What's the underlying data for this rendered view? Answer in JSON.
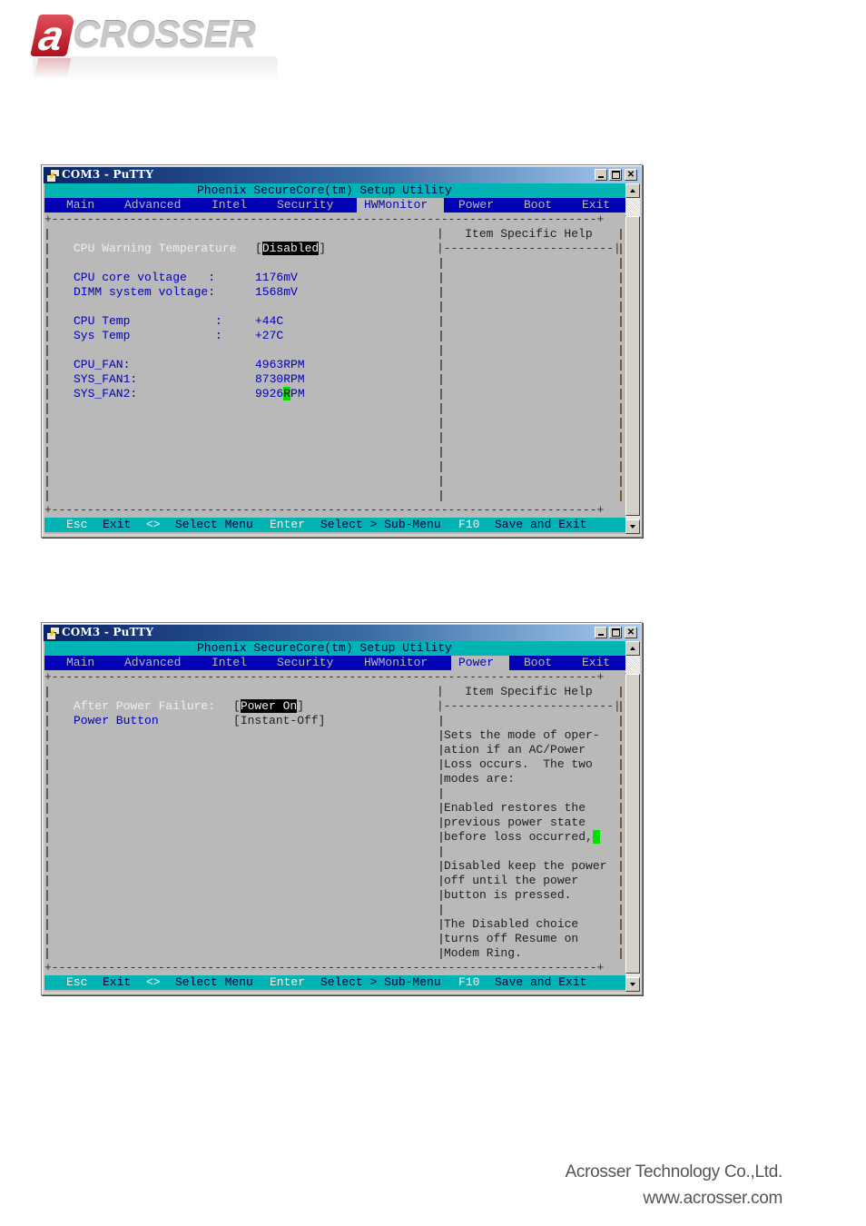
{
  "logo": {
    "mark": "a",
    "text": "CROSSER"
  },
  "windows": [
    {
      "title": "COM3 - PuTTY",
      "banner": "Phoenix SecureCore(tm) Setup Utility",
      "menu": [
        "Main",
        "Advanced",
        "Intel",
        "Security",
        "HWMonitor",
        "Power",
        "Boot",
        "Exit"
      ],
      "selected_menu": "HWMonitor",
      "help_title": "Item Specific Help",
      "items": [
        {
          "label": "CPU Warning Temperature",
          "value": "Disabled",
          "selected": true
        },
        {
          "label": "CPU core voltage   :",
          "value": "1176mV"
        },
        {
          "label": "DIMM system voltage:",
          "value": "1568mV"
        },
        {
          "label": "CPU Temp            :",
          "value": "+44C"
        },
        {
          "label": "Sys Temp            :",
          "value": "+27C"
        },
        {
          "label": "CPU_FAN:",
          "value": "4963RPM"
        },
        {
          "label": "SYS_FAN1:",
          "value": "8730RPM"
        },
        {
          "label": "SYS_FAN2:",
          "value_pre": "9926",
          "value_cursor": "R",
          "value_post": "PM"
        }
      ],
      "help_lines": [],
      "footer": [
        {
          "key": "Esc",
          "desc": "Exit"
        },
        {
          "key": "<>",
          "desc": "Select Menu"
        },
        {
          "key": "Enter",
          "desc": "Select > Sub-Menu"
        },
        {
          "key": "F10",
          "desc": "Save and Exit"
        }
      ]
    },
    {
      "title": "COM3 - PuTTY",
      "banner": "Phoenix SecureCore(tm) Setup Utility",
      "menu": [
        "Main",
        "Advanced",
        "Intel",
        "Security",
        "HWMonitor",
        "Power",
        "Boot",
        "Exit"
      ],
      "selected_menu": "Power",
      "help_title": "Item Specific Help",
      "items": [
        {
          "label": "After Power Failure:",
          "value": "Power On",
          "selected": true
        },
        {
          "label": "Power Button",
          "value": "Instant-Off"
        }
      ],
      "help_lines": [
        "",
        "Sets the mode of oper-",
        "ation if an AC/Power",
        "Loss occurs.  The two",
        "modes are:",
        "",
        "Enabled restores the",
        "previous power state",
        "before loss occurred,",
        "",
        "Disabled keep the power",
        "off until the power",
        "button is pressed.",
        "",
        "The Disabled choice",
        "turns off Resume on",
        "Modem Ring."
      ],
      "footer": [
        {
          "key": "Esc",
          "desc": "Exit"
        },
        {
          "key": "<>",
          "desc": "Select Menu"
        },
        {
          "key": "Enter",
          "desc": "Select > Sub-Menu"
        },
        {
          "key": "F10",
          "desc": "Save and Exit"
        }
      ]
    }
  ],
  "company": {
    "name": "Acrosser Technology Co.,Ltd.",
    "url": "www.acrosser.com"
  }
}
